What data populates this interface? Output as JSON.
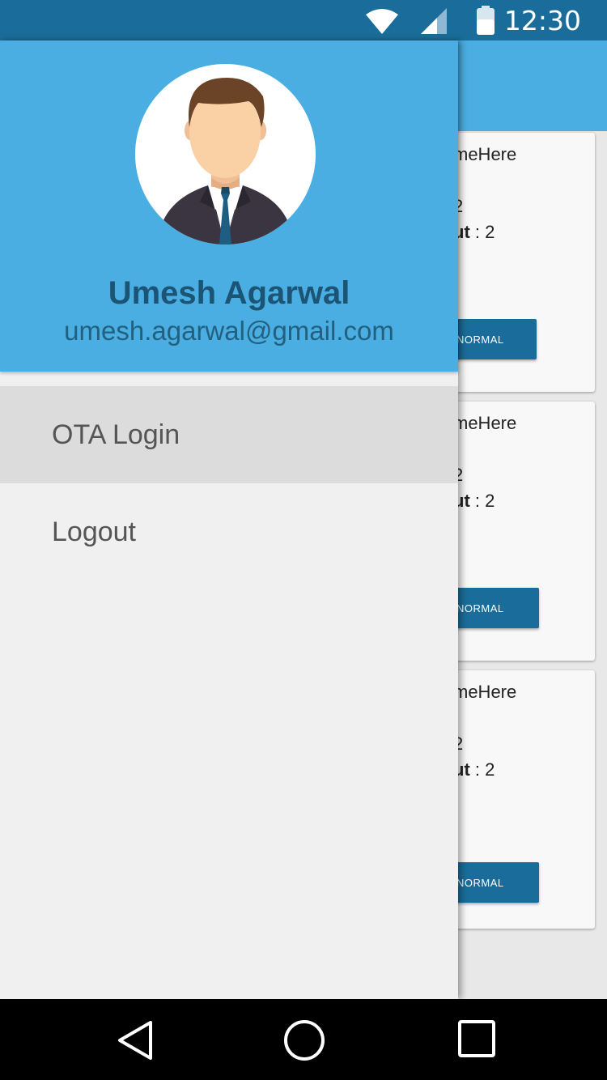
{
  "status_bar": {
    "time": "12:30",
    "icons": [
      "wifi-icon",
      "signal-icon",
      "battery-icon"
    ]
  },
  "background_cards": [
    {
      "name": "meHere",
      "count": "2",
      "out_label": "ut",
      "out_value": " : 2",
      "button_label": "NORMAL"
    },
    {
      "name": "meHere",
      "count": "2",
      "out_label": "ut",
      "out_value": " : 2",
      "button_label": "NORMAL"
    },
    {
      "name": "meHere",
      "count": "2",
      "out_label": "ut",
      "out_value": " : 2",
      "button_label": "NORMAL"
    }
  ],
  "drawer": {
    "user_name": "Umesh Agarwal",
    "user_email": "umesh.agarwal@gmail.com",
    "menu": [
      {
        "label": "OTA Login",
        "active": true
      },
      {
        "label": "Logout",
        "active": false
      }
    ]
  },
  "nav_bar": {
    "icons": [
      "back-icon",
      "home-icon",
      "recents-icon"
    ]
  },
  "colors": {
    "primary_dark": "#1a6d9a",
    "primary": "#4baee2",
    "name_text": "#1b5474"
  }
}
